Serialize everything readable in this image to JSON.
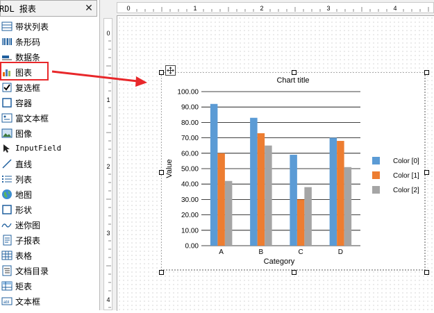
{
  "toolbox": {
    "title": "RDL 报表",
    "close_glyph": "✕",
    "items": [
      {
        "label": "带状列表",
        "icon": "table-list-icon"
      },
      {
        "label": "条形码",
        "icon": "barcode-icon"
      },
      {
        "label": "数据条",
        "icon": "databar-icon"
      },
      {
        "label": "图表",
        "icon": "chart-icon"
      },
      {
        "label": "复选框",
        "icon": "checkbox-icon"
      },
      {
        "label": "容器",
        "icon": "container-icon"
      },
      {
        "label": "富文本框",
        "icon": "richtext-icon"
      },
      {
        "label": "图像",
        "icon": "image-icon"
      },
      {
        "label": "InputField",
        "icon": "inputfield-icon"
      },
      {
        "label": "直线",
        "icon": "line-icon"
      },
      {
        "label": "列表",
        "icon": "list-icon"
      },
      {
        "label": "地图",
        "icon": "globe-icon"
      },
      {
        "label": "形状",
        "icon": "shape-icon"
      },
      {
        "label": "迷你图",
        "icon": "sparkline-icon"
      },
      {
        "label": "子报表",
        "icon": "subreport-icon"
      },
      {
        "label": "表格",
        "icon": "table-icon"
      },
      {
        "label": "文档目录",
        "icon": "toc-icon"
      },
      {
        "label": "矩表",
        "icon": "matrix-icon"
      },
      {
        "label": "文本框",
        "icon": "textbox-icon"
      }
    ],
    "highlight_color": "#e8272a"
  },
  "rulers": {
    "top_labels": [
      "0",
      "1",
      "2",
      "3",
      "4"
    ],
    "left_labels": [
      "0",
      "1",
      "2",
      "3",
      "4"
    ]
  },
  "chart_data": {
    "type": "bar",
    "title": "Chart title",
    "xlabel": "Category",
    "ylabel": "Value",
    "categories": [
      "A",
      "B",
      "C",
      "D"
    ],
    "ylim": [
      0,
      100
    ],
    "yticks": [
      "100.00",
      "90.00",
      "80.00",
      "70.00",
      "60.00",
      "50.00",
      "40.00",
      "30.00",
      "20.00",
      "10.00",
      "0.00"
    ],
    "series": [
      {
        "name": "Color [0]",
        "values": [
          92,
          83,
          59,
          70
        ],
        "color": "#5b9bd5"
      },
      {
        "name": "Color [1]",
        "values": [
          60,
          73,
          30,
          68
        ],
        "color": "#ed7d31"
      },
      {
        "name": "Color [2]",
        "values": [
          42,
          65,
          38,
          51
        ],
        "color": "#a5a5a5"
      }
    ],
    "legend_position": "right",
    "grid": true
  }
}
